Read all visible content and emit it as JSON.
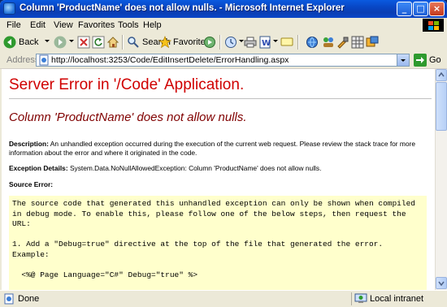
{
  "window": {
    "title": "Column 'ProductName' does not allow nulls. - Microsoft Internet Explorer"
  },
  "menu": [
    "File",
    "Edit",
    "View",
    "Favorites",
    "Tools",
    "Help"
  ],
  "toolbar": {
    "back": "Back",
    "search": "Search",
    "favorites": "Favorites"
  },
  "address": {
    "label": "Address",
    "url": "http://localhost:3253/Code/EditInsertDelete/ErrorHandling.aspx",
    "go": "Go"
  },
  "page": {
    "heading": "Server Error in '/Code' Application.",
    "error_title": "Column 'ProductName' does not allow nulls.",
    "description_label": "Description:",
    "description_line1": "An unhandled exception occurred during the execution of the current web request. Please review the stack trace for more",
    "description_line2": "information about the error and where it originated in the code.",
    "exception_label": "Exception Details:",
    "exception_text": "System.Data.NoNullAllowedException: Column 'ProductName' does not allow nulls.",
    "source_label": "Source Error:",
    "code_lines": [
      "The source code that generated this unhandled exception can only be shown when compiled",
      "in debug mode. To enable this, please follow one of the below steps, then request the",
      "URL:",
      "",
      "1. Add a \"Debug=true\" directive at the top of the file that generated the error.",
      "Example:",
      "",
      "  <%@ Page Language=\"C#\" Debug=\"true\" %>"
    ]
  },
  "status": {
    "text": "Done",
    "zone": "Local intranet"
  },
  "colors": {
    "heading": "#d00000",
    "error_title": "#800000",
    "code_bg": "#ffffcc"
  }
}
